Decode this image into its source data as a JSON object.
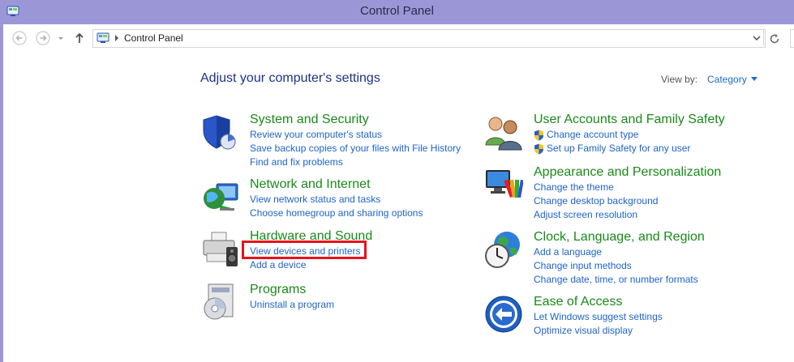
{
  "window": {
    "title": "Control Panel",
    "app_icon": "control-panel-icon"
  },
  "address_bar": {
    "back_icon": "back-arrow-icon",
    "forward_icon": "forward-arrow-icon",
    "recent_icon": "chevron-down-icon",
    "up_icon": "up-arrow-icon",
    "location_icon": "control-panel-icon",
    "breadcrumb": "Control Panel",
    "refresh_icon": "refresh-icon"
  },
  "main": {
    "heading": "Adjust your computer's settings",
    "view_by_label": "View by:",
    "view_by_value": "Category"
  },
  "categories_left": [
    {
      "title": "System and Security",
      "icon": "shield-security-icon",
      "links": [
        "Review your computer's status",
        "Save backup copies of your files with File History",
        "Find and fix problems"
      ]
    },
    {
      "title": "Network and Internet",
      "icon": "network-globe-icon",
      "links": [
        "View network status and tasks",
        "Choose homegroup and sharing options"
      ]
    },
    {
      "title": "Hardware and Sound",
      "icon": "printer-speaker-icon",
      "links": [
        "View devices and printers",
        "Add a device"
      ]
    },
    {
      "title": "Programs",
      "icon": "programs-disc-icon",
      "links": [
        "Uninstall a program"
      ]
    }
  ],
  "categories_right": [
    {
      "title": "User Accounts and Family Safety",
      "icon": "users-icon",
      "links": [
        "Change account type",
        "Set up Family Safety for any user"
      ]
    },
    {
      "title": "Appearance and Personalization",
      "icon": "monitor-palette-icon",
      "links": [
        "Change the theme",
        "Change desktop background",
        "Adjust screen resolution"
      ]
    },
    {
      "title": "Clock, Language, and Region",
      "icon": "clock-globe-icon",
      "links": [
        "Add a language",
        "Change input methods",
        "Change date, time, or number formats"
      ]
    },
    {
      "title": "Ease of Access",
      "icon": "ease-of-access-icon",
      "links": [
        "Let Windows suggest settings",
        "Optimize visual display"
      ]
    }
  ],
  "colors": {
    "title_bar": "#9b97d6",
    "heading": "#1e3287",
    "category_title": "#1a8a1a",
    "link": "#1e64c8",
    "highlight_box": "#e8111b"
  }
}
